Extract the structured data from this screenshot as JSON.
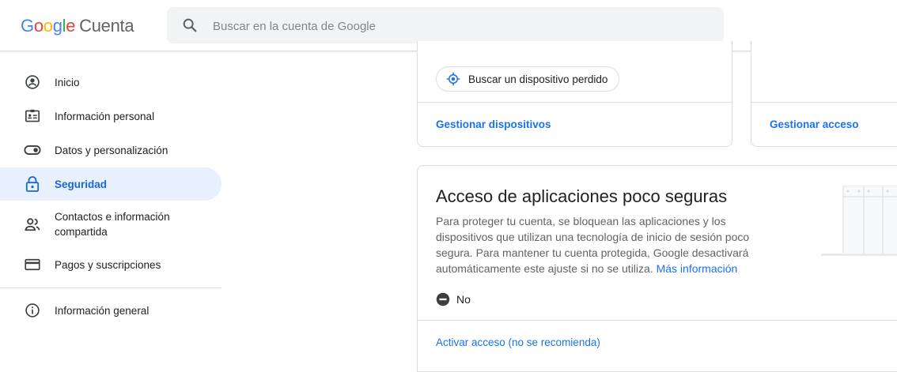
{
  "header": {
    "logo_letters": [
      "G",
      "o",
      "o",
      "g",
      "l",
      "e"
    ],
    "logo_word": "Cuenta",
    "search_placeholder": "Buscar en la cuenta de Google"
  },
  "sidebar": {
    "items": [
      {
        "label": "Inicio",
        "icon": "account-circle-icon"
      },
      {
        "label": "Información personal",
        "icon": "id-card-icon"
      },
      {
        "label": "Datos y personalización",
        "icon": "toggle-icon"
      },
      {
        "label": "Seguridad",
        "icon": "lock-icon",
        "active": true
      },
      {
        "label": "Contactos e información compartida",
        "icon": "people-icon"
      },
      {
        "label": "Pagos y suscripciones",
        "icon": "credit-card-icon"
      },
      {
        "label": "Información general",
        "icon": "info-icon"
      }
    ]
  },
  "devices_card": {
    "find_device_label": "Buscar un dispositivo perdido",
    "manage_link": "Gestionar dispositivos"
  },
  "access_card": {
    "manage_link": "Gestionar acceso"
  },
  "less_secure_card": {
    "title": "Acceso de aplicaciones poco seguras",
    "description": "Para proteger tu cuenta, se bloquean las aplicaciones y los dispositivos que utilizan una tecnología de inicio de sesión poco segura. Para mantener tu cuenta protegida, Google desactivará automáticamente este ajuste si no se utiliza.",
    "more_info": "Más información",
    "status": "No",
    "action_link": "Activar acceso (no se recomienda)"
  },
  "colors": {
    "accent": "#1a73e8",
    "active_bg": "#e8f0fe",
    "border": "#dadce0"
  }
}
